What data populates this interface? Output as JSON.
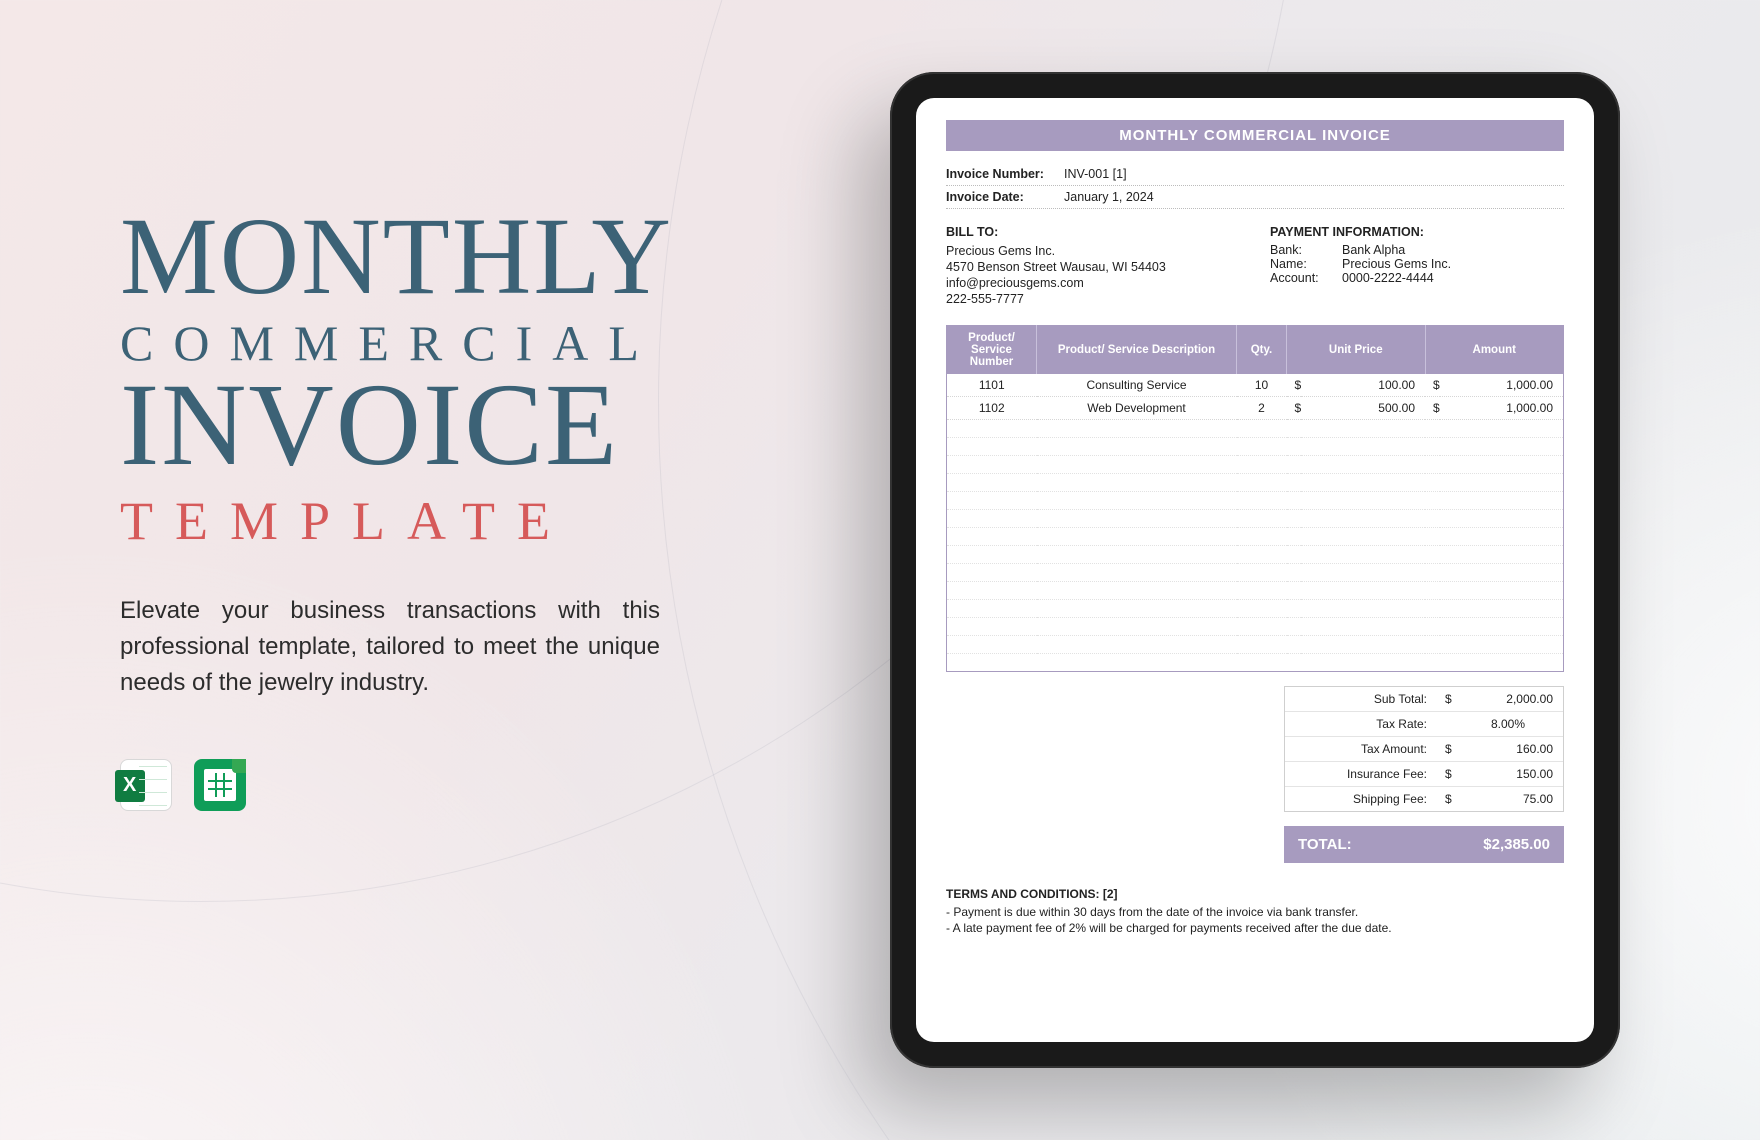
{
  "promo": {
    "line1": "MONTHLY",
    "line2": "COMMERCIAL",
    "line3": "INVOICE",
    "line4": "TEMPLATE",
    "description": "Elevate your business transactions with this professional template, tailored to meet the unique needs of the jewelry industry."
  },
  "invoice": {
    "title": "MONTHLY COMMERCIAL INVOICE",
    "number_label": "Invoice Number:",
    "number_value": "INV-001 [1]",
    "date_label": "Invoice Date:",
    "date_value": "January 1, 2024",
    "bill_to": {
      "heading": "BILL TO:",
      "name": "Precious Gems Inc.",
      "address": "4570 Benson Street Wausau, WI 54403",
      "email": "info@preciousgems.com",
      "phone": "222-555-7777"
    },
    "payment_info": {
      "heading": "PAYMENT INFORMATION:",
      "bank_label": "Bank:",
      "bank_value": "Bank Alpha",
      "name_label": "Name:",
      "name_value": "Precious Gems Inc.",
      "account_label": "Account:",
      "account_value": "0000-2222-4444"
    },
    "columns": {
      "c1": "Product/ Service Number",
      "c2": "Product/ Service Description",
      "c3": "Qty.",
      "c4": "Unit Price",
      "c5": "Amount"
    },
    "items": [
      {
        "num": "1101",
        "desc": "Consulting Service",
        "qty": "10",
        "unit": "100.00",
        "amount": "1,000.00"
      },
      {
        "num": "1102",
        "desc": "Web Development",
        "qty": "2",
        "unit": "500.00",
        "amount": "1,000.00"
      }
    ],
    "currency": "$",
    "totals": {
      "subtotal_label": "Sub Total:",
      "subtotal": "2,000.00",
      "taxrate_label": "Tax Rate:",
      "taxrate": "8.00%",
      "taxamt_label": "Tax Amount:",
      "taxamt": "160.00",
      "ins_label": "Insurance Fee:",
      "ins": "150.00",
      "ship_label": "Shipping Fee:",
      "ship": "75.00"
    },
    "grand_label": "TOTAL:",
    "grand_value": "$2,385.00",
    "terms": {
      "heading": "TERMS AND CONDITIONS: [2]",
      "t1": "- Payment is due within 30 days from the date of the invoice via bank transfer.",
      "t2": "- A late payment fee of 2% will be charged for payments received after the due date."
    }
  }
}
